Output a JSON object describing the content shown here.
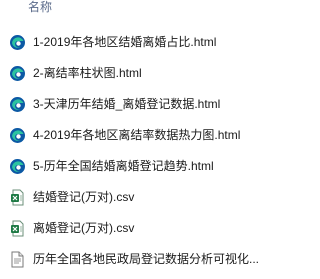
{
  "header": {
    "name_column": "名称"
  },
  "files": [
    {
      "name": "1-2019年各地区结婚离婚占比.html",
      "icon": "edge-icon"
    },
    {
      "name": "2-离结率柱状图.html",
      "icon": "edge-icon"
    },
    {
      "name": "3-天津历年结婚_离婚登记数据.html",
      "icon": "edge-icon"
    },
    {
      "name": "4-2019年各地区离结率数据热力图.html",
      "icon": "edge-icon"
    },
    {
      "name": "5-历年全国结婚离婚登记趋势.html",
      "icon": "edge-icon"
    },
    {
      "name": "结婚登记(万对).csv",
      "icon": "csv-icon"
    },
    {
      "name": "离婚登记(万对).csv",
      "icon": "csv-icon"
    },
    {
      "name": "历年全国各地民政局登记数据分析可视化...",
      "icon": "doc-icon"
    }
  ],
  "colors": {
    "edge_blue": "#0c59a4",
    "edge_teal": "#2bc3a0",
    "csv_green": "#1e7a45",
    "header_text": "#5a6a8a"
  }
}
